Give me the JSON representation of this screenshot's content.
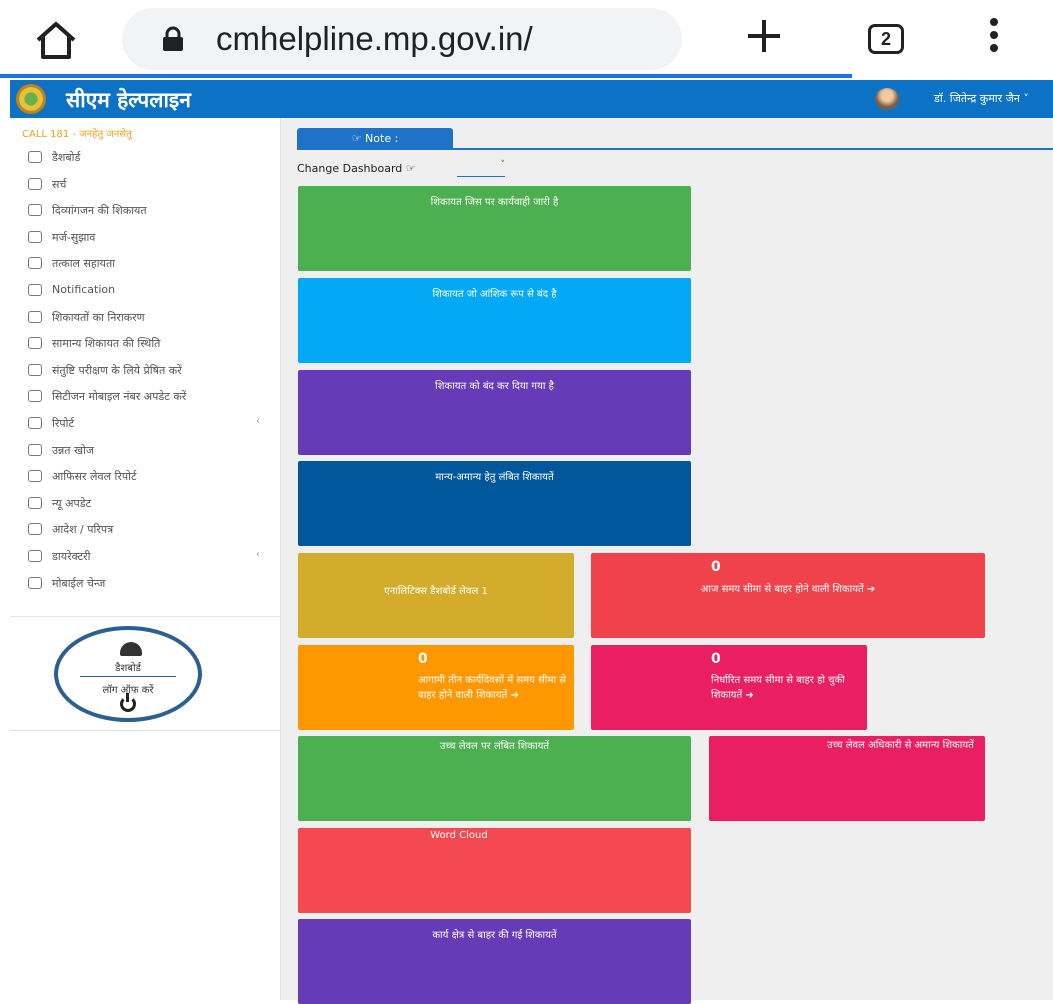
{
  "browser": {
    "url": "cmhelpline.mp.gov.in/",
    "tab_count": "2"
  },
  "header": {
    "app_title": "सीएम हेल्पलाइन",
    "user_name": "डॉ. जितेन्द्र कुमार जैन ˅"
  },
  "sidebar": {
    "call_line": "CALL 181 - जनहेतु जनसेतु",
    "items": [
      {
        "label": "डैशबोर्ड",
        "icon": "dashboard-icon"
      },
      {
        "label": "सर्च",
        "icon": "search-icon"
      },
      {
        "label": "दिव्यांगजन की शिकायत",
        "icon": "disabled-icon"
      },
      {
        "label": "मर्ज-सुझाव",
        "icon": "merge-icon"
      },
      {
        "label": "तत्काल सहायता",
        "icon": "help-icon"
      },
      {
        "label": "Notification",
        "icon": "notification-icon"
      },
      {
        "label": "शिकायतों का निराकरण",
        "icon": "resolve-icon"
      },
      {
        "label": "सामान्य शिकायत की स्थिति",
        "icon": "status-icon"
      },
      {
        "label": "संतुष्टि परीक्षण के लिये प्रेषित करें",
        "icon": "send-icon"
      },
      {
        "label": "सिटीजन मोबाइल नंबर अपडेट करें",
        "icon": "mobile-icon"
      },
      {
        "label": "रिपोर्ट",
        "icon": "report-icon",
        "chevron": "‹"
      },
      {
        "label": "उन्नत खोज",
        "icon": "advanced-search-icon"
      },
      {
        "label": "आफिसर लेवल रिपोर्ट",
        "icon": "officer-report-icon"
      },
      {
        "label": "न्यू अपडेट",
        "icon": "new-update-icon"
      },
      {
        "label": "आदेश / परिपत्र",
        "icon": "order-icon"
      },
      {
        "label": "डायरेक्टरी",
        "icon": "directory-icon",
        "chevron": "‹"
      },
      {
        "label": "मोबाईल चेन्ज",
        "icon": "mobile-change-icon"
      }
    ],
    "dashboard_label": "डैशबोर्ड",
    "logout_label": "लॉग ऑफ करें"
  },
  "main": {
    "note_label": "☞ Note :",
    "change_dashboard": "Change Dashboard ☞",
    "select_value": "˅",
    "cards": [
      {
        "title": "शिकायत जिस पर कार्यवाही जारी है",
        "color": "#4caf50"
      },
      {
        "title": "शिकायत जो आंशिक रूप से बंद है",
        "color": "#03a9f4"
      },
      {
        "title": "शिकायत को बंद कर दिया गया है",
        "color": "#673ab7"
      },
      {
        "title": "मान्य-अमान्य हेतु लंबित शिकायतें",
        "color": "#01579b"
      },
      {
        "title": "एनालिटिक्स डैशबोर्ड लेवल 1",
        "color": "#d4ac2b"
      },
      {
        "count": "0",
        "title": "आज समय सीमा से बाहर होने वाली शिकायतें ➔",
        "color": "#f0424a"
      },
      {
        "count": "0",
        "title": "आगामी तीन कार्यदिवसों में समय सीमा से बाहर होने वाली शिकायतें ➔",
        "color": "#ff9800"
      },
      {
        "count": "0",
        "title": "निर्धारित समय सीमा से बाहर हो चुकी शिकायतें ➔",
        "color": "#e91e63"
      },
      {
        "title": "उच्च लेवल पर लंबित शिकायतें",
        "color": "#4caf50"
      },
      {
        "title": "उच्च लेवल अधिकारी से अमान्य शिकायतें",
        "color": "#e91e63"
      },
      {
        "title": "Word Cloud",
        "color": "#f44950"
      },
      {
        "title": "कार्य क्षेत्र से बाहर की गई शिकायतें",
        "color": "#673ab7"
      }
    ]
  }
}
